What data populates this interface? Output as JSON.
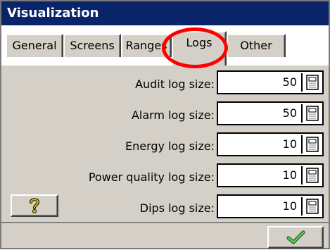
{
  "window": {
    "title": "Visualization"
  },
  "tabs": [
    {
      "label": "General",
      "active": false
    },
    {
      "label": "Screens",
      "active": false
    },
    {
      "label": "Ranges",
      "active": false
    },
    {
      "label": "Logs",
      "active": true
    },
    {
      "label": "Other",
      "active": false
    }
  ],
  "fields": [
    {
      "label": "Audit log size:",
      "value": "50"
    },
    {
      "label": "Alarm log size:",
      "value": "50"
    },
    {
      "label": "Energy log size:",
      "value": "10"
    },
    {
      "label": "Power quality log size:",
      "value": "10"
    },
    {
      "label": "Dips log size:",
      "value": "10"
    }
  ],
  "buttons": {
    "help_icon": "question-mark-icon",
    "ok_icon": "checkmark-icon"
  },
  "colors": {
    "titlebar": "#0a246a",
    "highlight": "#ff0000",
    "checkmark": "#2e9b2e",
    "help_glyph": "#e0c000"
  }
}
